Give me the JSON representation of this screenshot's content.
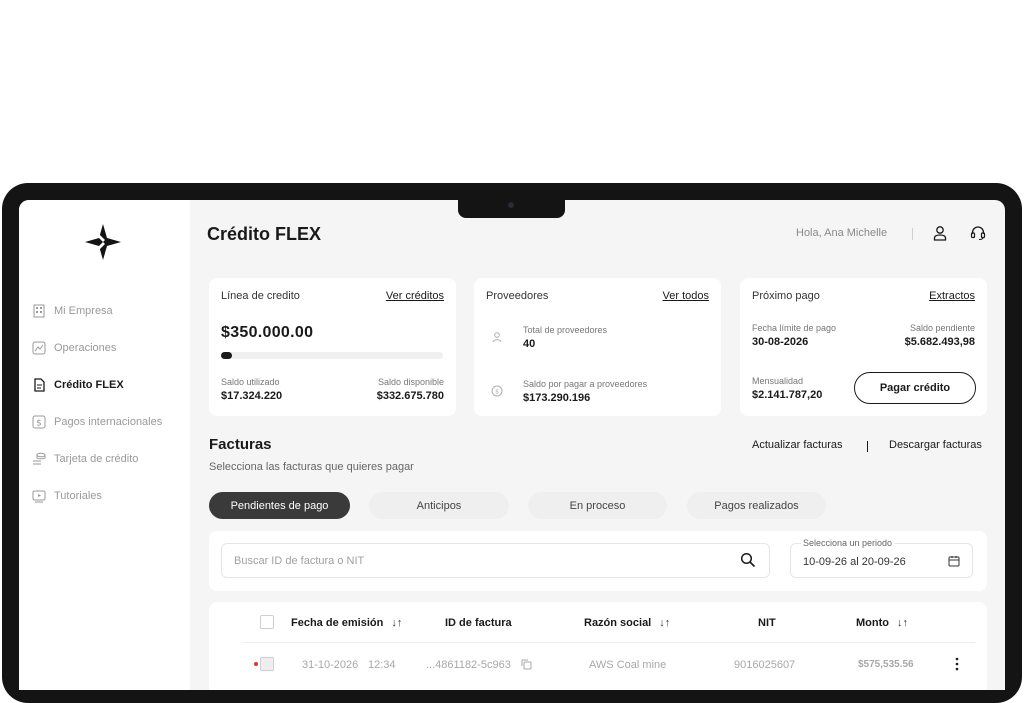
{
  "app": {
    "title": "Crédito FLEX",
    "greeting": "Hola, Ana Michelle"
  },
  "sidebar": {
    "items": [
      {
        "label": "Mi Empresa",
        "icon": "building-icon",
        "active": false
      },
      {
        "label": "Operaciones",
        "icon": "chart-icon",
        "active": false
      },
      {
        "label": "Crédito FLEX",
        "icon": "document-icon",
        "active": true
      },
      {
        "label": "Pagos internacionales",
        "icon": "dollar-icon",
        "active": false
      },
      {
        "label": "Tarjeta de crédito",
        "icon": "card-coins-icon",
        "active": false
      },
      {
        "label": "Tutoriales",
        "icon": "video-icon",
        "active": false
      }
    ]
  },
  "cards": {
    "credit_line": {
      "title": "Línea de credito",
      "link": "Ver créditos",
      "amount": "$350.000.00",
      "used_fraction": 0.05,
      "used_label": "Saldo utilizado",
      "used_value": "$17.324.220",
      "available_label": "Saldo disponible",
      "available_value": "$332.675.780"
    },
    "suppliers": {
      "title": "Proveedores",
      "link": "Ver todos",
      "total_label": "Total de proveedores",
      "total_value": "40",
      "pending_label": "Saldo por pagar a proveedores",
      "pending_value": "$173.290.196"
    },
    "next_payment": {
      "title": "Próximo pago",
      "link": "Extractos",
      "due_label": "Fecha límite de pago",
      "due_value": "30-08-2026",
      "balance_label": "Saldo pendiente",
      "balance_value": "$5.682.493,98",
      "monthly_label": "Mensualidad",
      "monthly_value": "$2.141.787,20",
      "pay_button": "Pagar crédito"
    }
  },
  "invoices": {
    "title": "Facturas",
    "subtitle": "Selecciona las facturas que quieres pagar",
    "update_action": "Actualizar facturas",
    "download_action": "Descargar facturas",
    "tabs": [
      "Pendientes de pago",
      "Anticipos",
      "En proceso",
      "Pagos realizados"
    ],
    "active_tab": 0,
    "search_placeholder": "Buscar ID de factura o NIT",
    "period_label": "Selecciona un periodo",
    "period_value": "10-09-26 al 20-09-26",
    "columns": {
      "date": "Fecha de emisión",
      "id": "ID de factura",
      "company": "Razón social",
      "nit": "NIT",
      "amount": "Monto"
    },
    "sort_glyph": "↓↑",
    "rows": [
      {
        "date": "31-10-2026",
        "time": "12:34",
        "id": "...4861182-5c963",
        "company": "AWS Coal mine",
        "nit": "9016025607",
        "amount": "$575,535.56"
      }
    ]
  },
  "colors": {
    "accent": "#1a1a1a",
    "status_dot": "#e03030",
    "background": "#f5f5f5"
  }
}
